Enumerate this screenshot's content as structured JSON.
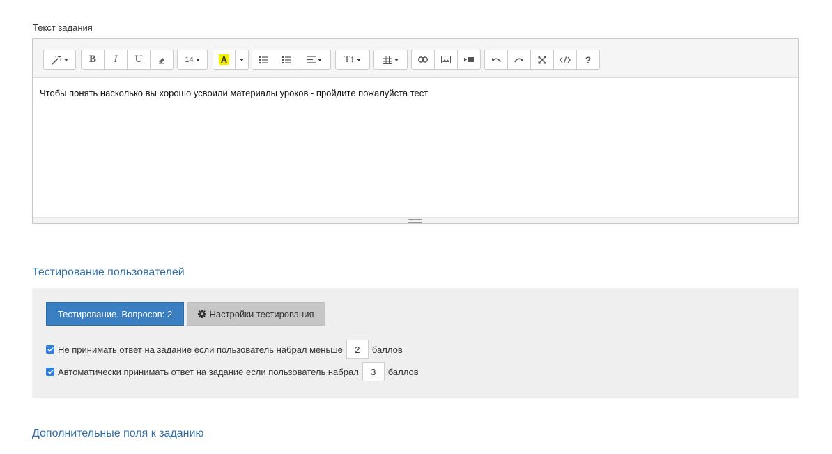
{
  "task_text": {
    "label": "Текст задания",
    "content": "Чтобы понять насколько вы хорошо усвоили материалы уроков - пройдите пожалуйста тест"
  },
  "toolbar": {
    "font_size": "14",
    "bold": "B",
    "italic": "I",
    "underline": "U",
    "help": "?",
    "highlight_glyph": "A",
    "highlight_color": "#f6f000",
    "text_size_glyph": "T↕"
  },
  "testing": {
    "section_title": "Тестирование пользователей",
    "questions_button": "Тестирование. Вопросов: 2",
    "settings_button": "Настройки тестирования",
    "option1": {
      "checked": true,
      "text": "Не принимать ответ на задание если пользователь набрал меньше",
      "value": "2",
      "suffix": "баллов"
    },
    "option2": {
      "checked": true,
      "text": "Автоматически принимать ответ на задание если пользователь набрал",
      "value": "3",
      "suffix": "баллов"
    }
  },
  "extra_fields": {
    "section_title": "Дополнительные поля к заданию"
  },
  "colors": {
    "primary": "#3a7fc1",
    "section_title": "#2f6fa7",
    "checkbox": "#2f7fdf"
  }
}
